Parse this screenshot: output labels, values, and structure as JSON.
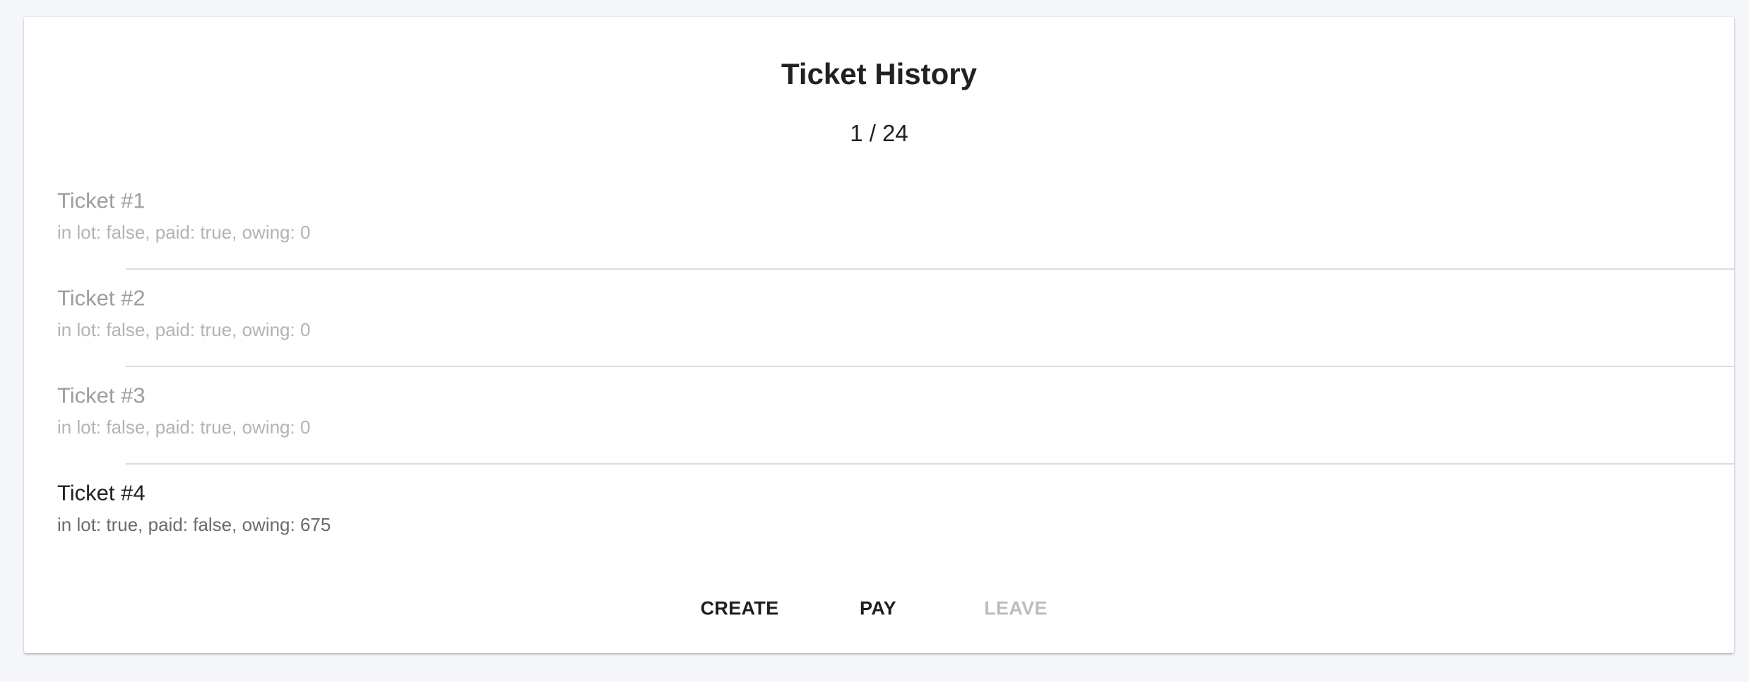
{
  "card": {
    "title": "Ticket History",
    "pagination": "1 / 24"
  },
  "tickets": [
    {
      "title": "Ticket #1",
      "details": "in lot: false, paid: true, owing: 0",
      "state": "disabled"
    },
    {
      "title": "Ticket #2",
      "details": "in lot: false, paid: true, owing: 0",
      "state": "disabled"
    },
    {
      "title": "Ticket #3",
      "details": "in lot: false, paid: true, owing: 0",
      "state": "disabled"
    },
    {
      "title": "Ticket #4",
      "details": "in lot: true, paid: false, owing: 675",
      "state": "active"
    }
  ],
  "actions": {
    "create_label": "CREATE",
    "pay_label": "PAY",
    "leave_label": "LEAVE",
    "leave_disabled": true
  },
  "colors": {
    "background": "#f5f6fa",
    "card": "#ffffff",
    "text_primary": "#212121",
    "text_disabled": "#9e9e9e",
    "button_disabled": "#bdbdbd"
  }
}
